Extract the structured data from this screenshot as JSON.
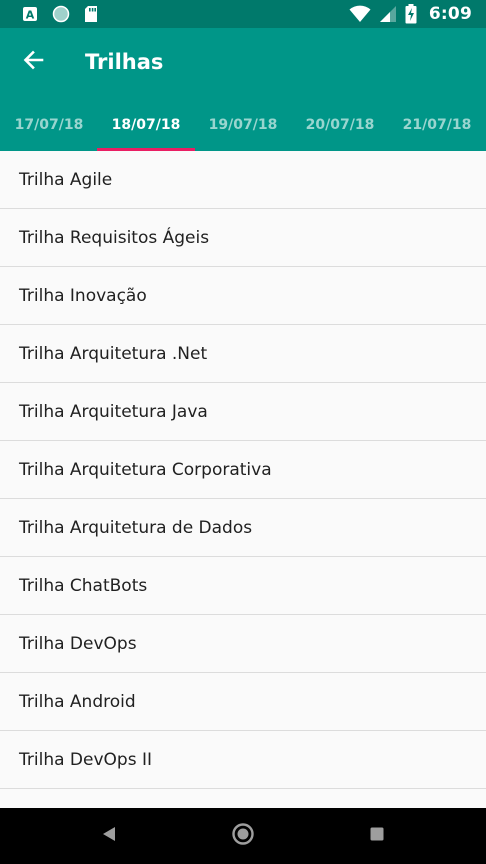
{
  "status_bar": {
    "time": "6:09",
    "left_icons": [
      "app-a-icon",
      "circle-icon",
      "sd-card-icon"
    ],
    "right_icons": [
      "wifi-icon",
      "signal-icon",
      "battery-charging-icon"
    ]
  },
  "app_bar": {
    "title": "Trilhas",
    "back_icon": "arrow-back-icon"
  },
  "tabs": [
    {
      "label": "17/07/18",
      "active": false
    },
    {
      "label": "18/07/18",
      "active": true
    },
    {
      "label": "19/07/18",
      "active": false
    },
    {
      "label": "20/07/18",
      "active": false
    },
    {
      "label": "21/07/18",
      "active": false
    }
  ],
  "tracks": [
    "Trilha Agile",
    "Trilha Requisitos Ágeis",
    "Trilha Inovação",
    "Trilha Arquitetura .Net",
    "Trilha Arquitetura Java",
    "Trilha Arquitetura Corporativa",
    "Trilha Arquitetura de Dados",
    "Trilha ChatBots",
    "Trilha DevOps",
    "Trilha Android",
    "Trilha DevOps II",
    ""
  ],
  "nav_bar": {
    "buttons": [
      "back-triangle-icon",
      "home-circle-icon",
      "recents-square-icon"
    ]
  },
  "colors": {
    "primary": "#009688",
    "primary_dark": "#00796b",
    "accent": "#e91e63"
  }
}
